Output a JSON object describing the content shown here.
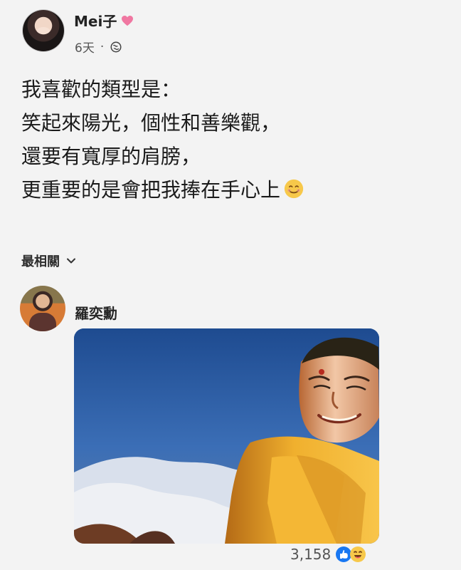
{
  "post": {
    "author": "Mei子",
    "time": "6天",
    "separator": "·",
    "text": "我喜歡的類型是：\n笑起來陽光，個性和善樂觀，\n還要有寬厚的肩膀，\n更重要的是會把我捧在手心上"
  },
  "comments": {
    "sort_label": "最相關",
    "commenter_name": "羅奕勳",
    "reaction_count": "3,158"
  },
  "colors": {
    "background": "#f3f3f3",
    "text": "#1b1b1b",
    "muted": "#555555",
    "heart": "#f077a1",
    "like_blue": "#1877f2",
    "laugh_yellow": "#f7c84a"
  },
  "icons": {
    "heart": "heart-icon",
    "globe": "globe-icon",
    "sort_chevron": "chevron-down-icon",
    "emoji": "smile-emoji",
    "reactions": [
      "like-icon",
      "laugh-icon"
    ]
  }
}
